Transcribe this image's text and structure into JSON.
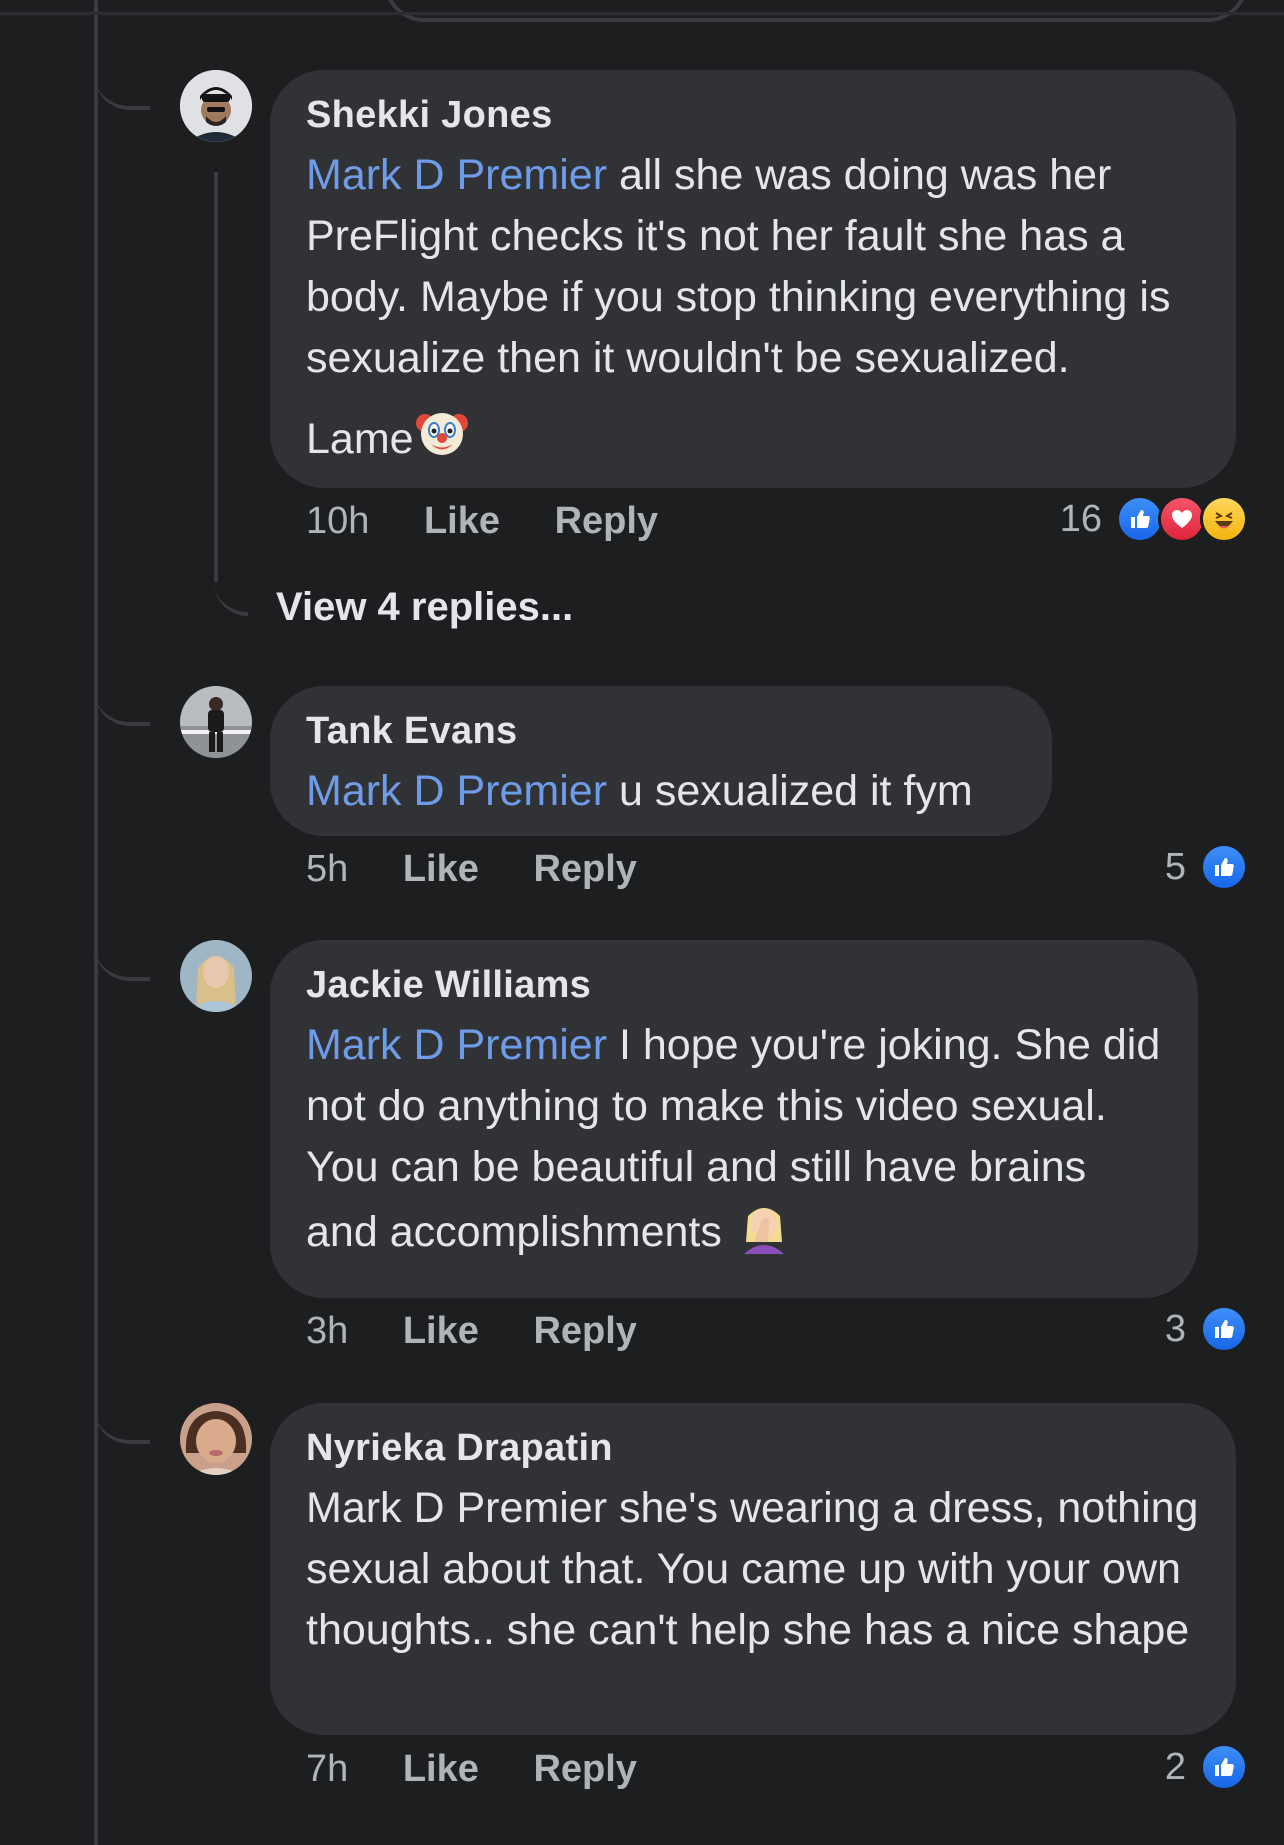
{
  "comments": [
    {
      "author": "Shekki Jones",
      "mention": "Mark D Premier",
      "text": " all she was doing was her PreFlight checks it's not her fault she has a body. Maybe if you stop thinking everything is sexualize then it wouldn't be sexualized.",
      "extra_text": "Lame",
      "extra_emoji": "clown-face",
      "time": "10h",
      "like_label": "Like",
      "reply_label": "Reply",
      "reaction_count": "16",
      "reactions": [
        "like",
        "love",
        "haha"
      ],
      "view_replies": "View 4 replies..."
    },
    {
      "author": "Tank Evans",
      "mention": "Mark D Premier",
      "text": " u sexualized it fym",
      "time": "5h",
      "like_label": "Like",
      "reply_label": "Reply",
      "reaction_count": "5",
      "reactions": [
        "like"
      ]
    },
    {
      "author": "Jackie Williams",
      "mention": "Mark D Premier",
      "text": " I hope you're joking. She did not do anything to make this video sexual. You can be beautiful and still have brains and accomplishments",
      "trailing_emoji": "woman-facepalming",
      "time": "3h",
      "like_label": "Like",
      "reply_label": "Reply",
      "reaction_count": "3",
      "reactions": [
        "like"
      ]
    },
    {
      "author": "Nyrieka Drapatin",
      "text": "Mark D Premier she's wearing a dress, nothing sexual about that. You came up with your own thoughts.. she can't help she has a nice shape",
      "time": "7h",
      "like_label": "Like",
      "reply_label": "Reply",
      "reaction_count": "2",
      "reactions": [
        "like"
      ]
    }
  ],
  "colors": {
    "background": "#1d1e20",
    "bubble": "#313235",
    "mention": "#6f9ce8",
    "meta": "#b0b3b8",
    "like_blue": "#1877f2"
  }
}
